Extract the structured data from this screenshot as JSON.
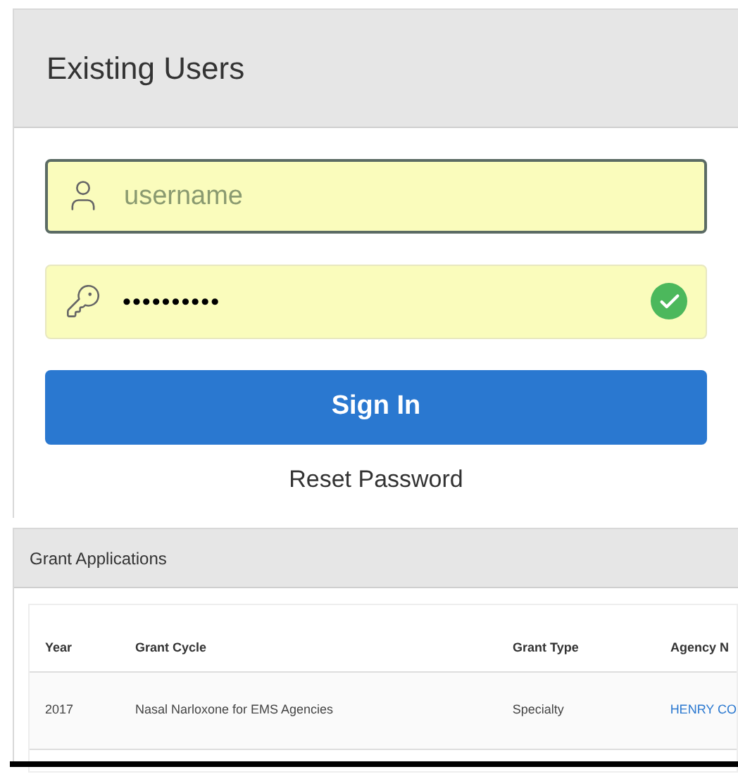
{
  "login_panel": {
    "title": "Existing Users",
    "username": {
      "placeholder": "username",
      "focused": true
    },
    "password": {
      "value": "••••••••••",
      "valid": true
    },
    "sign_in_button": "Sign In",
    "reset_link": "Reset Password"
  },
  "grant_panel": {
    "title": "Grant Applications",
    "table": {
      "columns": [
        {
          "label": "Year"
        },
        {
          "label": "Grant Cycle"
        },
        {
          "label": "Grant Type"
        },
        {
          "label": "Agency N"
        }
      ],
      "rows": [
        {
          "cells": [
            {
              "text": "2017",
              "kind": "text"
            },
            {
              "text": "Nasal Narloxone for EMS Agencies",
              "kind": "text"
            },
            {
              "text": "Specialty",
              "kind": "text"
            },
            {
              "text": "HENRY CO",
              "kind": "link"
            }
          ]
        }
      ]
    }
  }
}
